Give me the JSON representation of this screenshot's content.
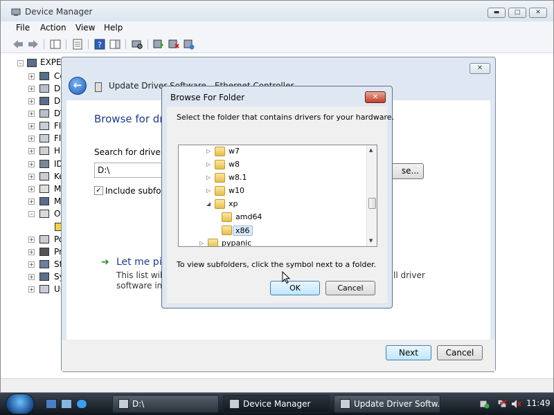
{
  "device_manager": {
    "title": "Device Manager",
    "menu": [
      "File",
      "Action",
      "View",
      "Help"
    ],
    "tree_root": "EXPER",
    "tree_items": [
      "Co",
      "Di",
      "Di",
      "DV",
      "Flo",
      "Flo",
      "Hu",
      "ID",
      "Ke",
      "M",
      "M",
      "Ot",
      "",
      "Po",
      "Pr",
      "St",
      "Sy",
      "Un"
    ]
  },
  "update_driver": {
    "title": "Update Driver Software - Ethernet Controller",
    "heading": "Browse for dri",
    "search_label": "Search for driver so",
    "path_value": "D:\\",
    "browse_label": "se...",
    "include_subfolders_label": "Include subfold",
    "include_subfolders_checked": true,
    "let_me_label": "Let me pic",
    "description_line1": "This list will s",
    "description_line1_end": "ll driver",
    "description_line2": "software in t",
    "next_label": "Next",
    "cancel_label": "Cancel"
  },
  "browse_folder": {
    "title": "Browse For Folder",
    "instruction": "Select the folder that contains drivers for your hardware.",
    "tree": [
      {
        "label": "w7",
        "expander": "collapsed",
        "level": 1
      },
      {
        "label": "w8",
        "expander": "collapsed",
        "level": 1
      },
      {
        "label": "w8.1",
        "expander": "collapsed",
        "level": 1
      },
      {
        "label": "w10",
        "expander": "collapsed",
        "level": 1
      },
      {
        "label": "xp",
        "expander": "expanded",
        "level": 1
      },
      {
        "label": "amd64",
        "expander": "none",
        "level": 2
      },
      {
        "label": "x86",
        "expander": "none",
        "level": 2,
        "selected": true
      },
      {
        "label": "pypanic",
        "expander": "collapsed",
        "level": 0
      }
    ],
    "hint": "To view subfolders, click the symbol next to a folder.",
    "ok_label": "OK",
    "cancel_label": "Cancel"
  },
  "taskbar": {
    "tasks": [
      "D:\\",
      "Device Manager",
      "Update Driver Softw..."
    ],
    "clock": "11:49"
  }
}
